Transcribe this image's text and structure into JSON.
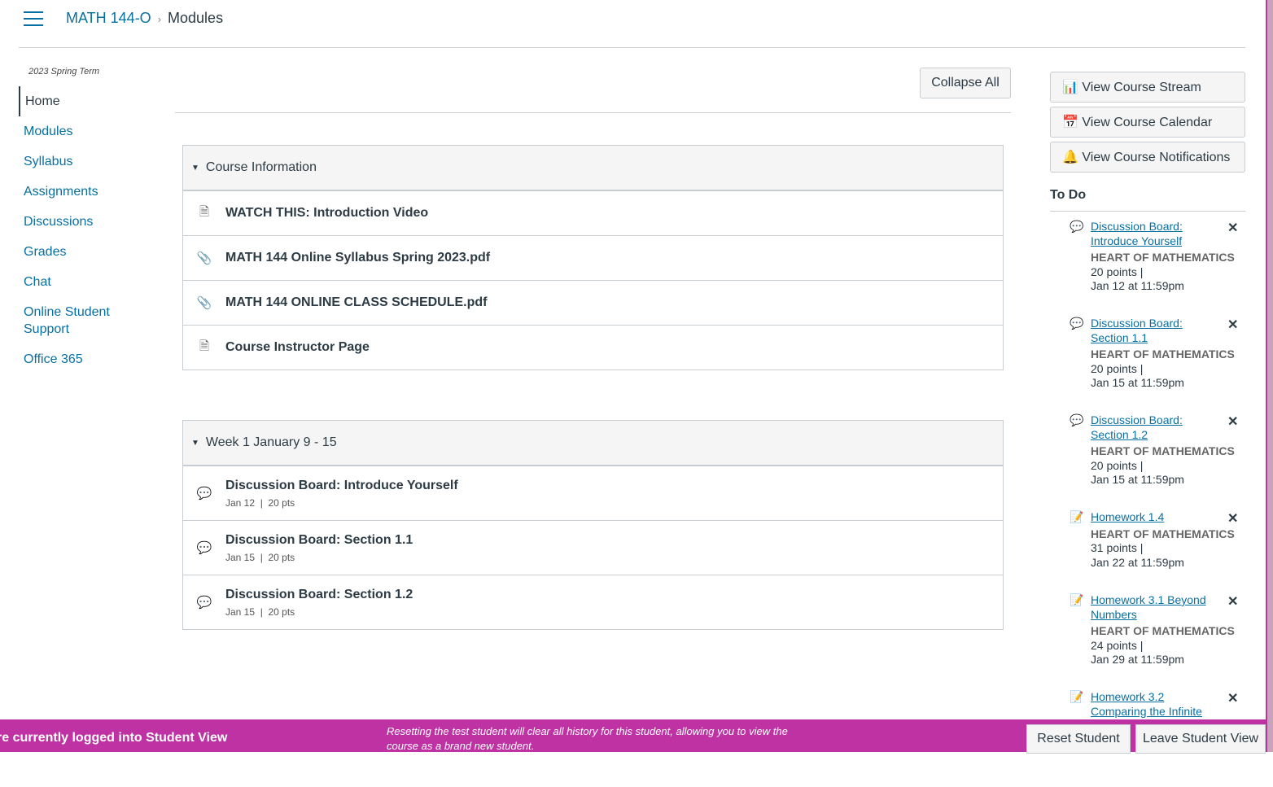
{
  "breadcrumb": {
    "course": "MATH 144-O",
    "page": "Modules"
  },
  "nav": {
    "term": "2023 Spring Term",
    "items": [
      "Home",
      "Modules",
      "Syllabus",
      "Assignments",
      "Discussions",
      "Grades",
      "Chat",
      "Online Student Support",
      "Office 365"
    ]
  },
  "collapse_all": "Collapse All",
  "modules": [
    {
      "title": "Course Information",
      "items": [
        {
          "icon": "page-icon",
          "title": "WATCH THIS: Introduction Video"
        },
        {
          "icon": "attachment-icon",
          "title": "MATH 144 Online Syllabus Spring 2023.pdf"
        },
        {
          "icon": "attachment-icon",
          "title": "MATH 144 ONLINE CLASS SCHEDULE.pdf"
        },
        {
          "icon": "page-icon",
          "title": "Course Instructor Page"
        }
      ]
    },
    {
      "title": "Week 1 January 9 - 15",
      "items": [
        {
          "icon": "discussion-icon",
          "title": "Discussion Board: Introduce Yourself",
          "date": "Jan 12",
          "pts": "20 pts"
        },
        {
          "icon": "discussion-icon",
          "title": "Discussion Board: Section 1.1",
          "date": "Jan 15",
          "pts": "20 pts"
        },
        {
          "icon": "discussion-icon",
          "title": "Discussion Board: Section 1.2",
          "date": "Jan 15",
          "pts": "20 pts"
        }
      ]
    }
  ],
  "right": {
    "stream": "View Course Stream",
    "calendar": "View Course Calendar",
    "notifications": "View Course Notifications",
    "todo_title": "To Do",
    "todo": [
      {
        "icon": "discussion-icon",
        "title": "Discussion Board: Introduce Yourself",
        "course": "HEART OF MATHEMATICS",
        "points": "20 points  |",
        "due": "Jan 12 at 11:59pm"
      },
      {
        "icon": "discussion-icon",
        "title": "Discussion Board: Section 1.1",
        "course": "HEART OF MATHEMATICS",
        "points": "20 points  |",
        "due": "Jan 15 at 11:59pm"
      },
      {
        "icon": "discussion-icon",
        "title": "Discussion Board: Section 1.2",
        "course": "HEART OF MATHEMATICS",
        "points": "20 points  |",
        "due": "Jan 15 at 11:59pm"
      },
      {
        "icon": "assignment-icon",
        "title": "Homework 1.4",
        "course": "HEART OF MATHEMATICS",
        "points": "31 points  |",
        "due": "Jan 22 at 11:59pm"
      },
      {
        "icon": "assignment-icon",
        "title": "Homework 3.1 Beyond Numbers",
        "course": "HEART OF MATHEMATICS",
        "points": "24 points  |",
        "due": "Jan 29 at 11:59pm"
      },
      {
        "icon": "assignment-icon",
        "title": "Homework 3.2 Comparing the Infinite",
        "course": "",
        "points": "",
        "due": ""
      }
    ]
  },
  "student_bar": {
    "message": "re currently logged into Student View",
    "info": "Resetting the test student will clear all history for this student, allowing you to view the course as a brand new student.",
    "reset": "Reset Student",
    "leave": "Leave Student View"
  }
}
